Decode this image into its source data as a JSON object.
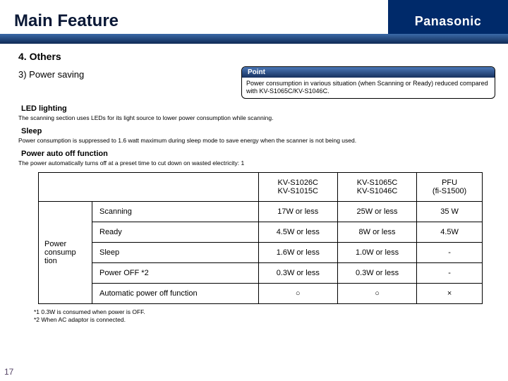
{
  "brand": "Panasonic",
  "title": "Main Feature",
  "section": "4. Others",
  "subtitle": "3) Power saving",
  "point": {
    "label": "Point",
    "body": "Power consumption in various situation (when Scanning or Ready) reduced compared with KV-S1065C/KV-S1046C."
  },
  "blocks": [
    {
      "head": "LED lighting",
      "desc": "The scanning section uses LEDs for its light source to lower power consumption while scanning."
    },
    {
      "head": "Sleep",
      "desc": "Power consumption is suppressed to 1.6 watt maximum during sleep mode to save energy when the scanner is not being used."
    },
    {
      "head": "Power auto off function",
      "desc": "The power automatically turns off at a preset time to cut down on wasted electricity: 1"
    }
  ],
  "table": {
    "group_label": "Power consump tion",
    "cols": [
      {
        "l1": "KV-S1026C",
        "l2": "KV-S1015C"
      },
      {
        "l1": "KV-S1065C",
        "l2": "KV-S1046C"
      },
      {
        "l1": "PFU",
        "l2": "(fi-S1500)"
      }
    ],
    "rows": [
      {
        "label": "Scanning",
        "v": [
          "17W or less",
          "25W or less",
          "35 W"
        ]
      },
      {
        "label": "Ready",
        "v": [
          "4.5W or less",
          "8W or less",
          "4.5W"
        ]
      },
      {
        "label": "Sleep",
        "v": [
          "1.6W or less",
          "1.0W or less",
          "-"
        ]
      },
      {
        "label": "Power OFF *2",
        "v": [
          "0.3W or less",
          "0.3W or less",
          "-"
        ]
      },
      {
        "label": "Automatic power off function",
        "v": [
          "○",
          "○",
          "×"
        ]
      }
    ]
  },
  "footnotes": {
    "f1": "*1  0.3W is consumed when power is OFF.",
    "f2": "*2  When AC adaptor is connected."
  },
  "page": "17"
}
